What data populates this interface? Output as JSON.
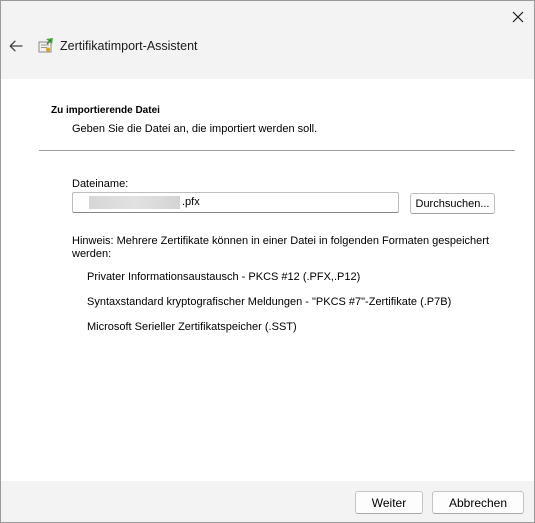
{
  "window": {
    "title": "Zertifikatimport-Assistent"
  },
  "section": {
    "title": "Zu importierende Datei",
    "description": "Geben Sie die Datei an, die importiert werden soll."
  },
  "file": {
    "label": "Dateiname:",
    "value_suffix": ".pfx",
    "browse_label": "Durchsuchen..."
  },
  "hint": {
    "text": "Hinweis: Mehrere Zertifikate können in einer Datei in folgenden Formaten gespeichert werden:",
    "formats": [
      "Privater Informationsaustausch - PKCS #12 (.PFX,.P12)",
      "Syntaxstandard kryptografischer Meldungen - \"PKCS #7\"-Zertifikate (.P7B)",
      "Microsoft Serieller Zertifikatspeicher (.SST)"
    ]
  },
  "footer": {
    "next_label": "Weiter",
    "cancel_label": "Abbrechen"
  },
  "icons": {
    "close": "close-icon",
    "back": "back-arrow-icon",
    "app": "certificate-icon"
  }
}
